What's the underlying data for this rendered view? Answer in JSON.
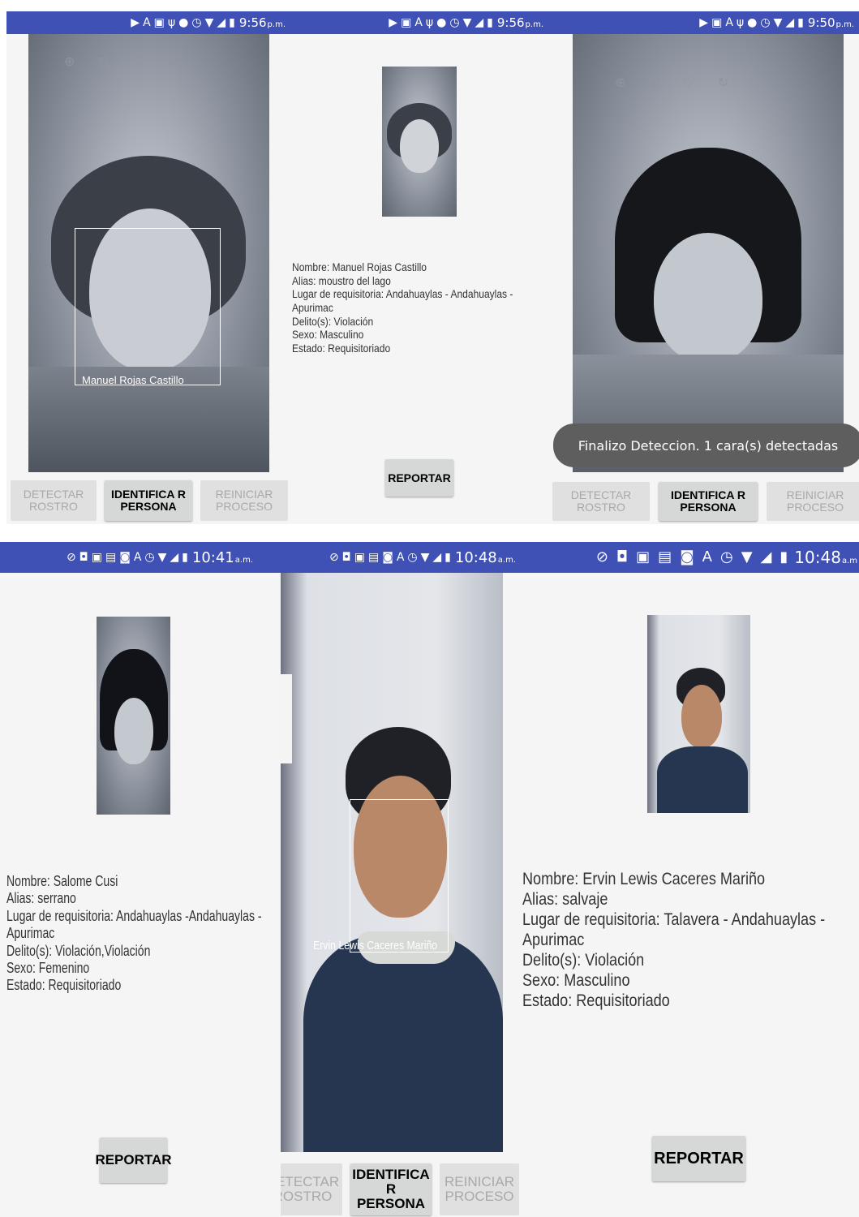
{
  "status_bars": {
    "p1": {
      "time": "9:56",
      "ampm": "p.m.",
      "icons": [
        "youtube-icon",
        "a-icon",
        "image-icon",
        "usb-icon",
        "android-icon",
        "alarm-icon",
        "wifi-icon",
        "signal-icon",
        "battery-icon"
      ]
    },
    "p2": {
      "time": "9:56",
      "ampm": "p.m.",
      "icons": [
        "youtube-icon",
        "image-icon",
        "a-icon",
        "usb-icon",
        "android-icon",
        "alarm-icon",
        "wifi-icon",
        "signal-icon",
        "battery-icon"
      ]
    },
    "p3": {
      "time": "9:50",
      "ampm": "p.m.",
      "icons": [
        "youtube-icon",
        "image-icon",
        "a-icon",
        "usb-icon",
        "android-icon",
        "alarm-icon",
        "wifi-icon",
        "signal-icon",
        "battery-icon"
      ]
    },
    "p4": {
      "time": "10:41",
      "ampm": "a.m.",
      "icons": [
        "block-icon",
        "app-icon",
        "image-icon",
        "gallery-icon",
        "chat-icon",
        "a-icon",
        "alarm-icon",
        "wifi-icon",
        "signal-icon",
        "battery-icon"
      ]
    },
    "p5": {
      "time": "10:48",
      "ampm": "a.m.",
      "icons": [
        "block-icon",
        "app-icon",
        "image-icon",
        "gallery-icon",
        "chat-icon",
        "a-icon",
        "alarm-icon",
        "wifi-icon",
        "signal-icon",
        "battery-icon"
      ]
    },
    "p6": {
      "time": "10:48",
      "ampm": "a.m",
      "icons": [
        "block-icon",
        "app-icon",
        "image-icon",
        "gallery-icon",
        "chat-icon",
        "a-icon",
        "alarm-icon",
        "wifi-icon",
        "signal-icon",
        "battery-icon"
      ]
    }
  },
  "buttons": {
    "detect": "DETECTAR ROSTRO",
    "identify": "IDENTIFICA R PERSONA",
    "restart": "REINICIAR PROCESO",
    "report": "REPORTAR"
  },
  "face_labels": {
    "p1": "Manuel Rojas Castillo",
    "p5": "Ervin Lewis Caceres Mariño"
  },
  "toast": "Finalizo Deteccion. 1 cara(s) detectadas",
  "records": {
    "p2": {
      "nombre": "Nombre: Manuel Rojas Castillo",
      "alias": "Alias: moustro del lago",
      "lugar": "Lugar de requisitoria: Andahuaylas - Andahuaylas -",
      "lugar2": "Apurimac",
      "delito": "Delito(s): Violación",
      "sexo": "Sexo: Masculino",
      "estado": "Estado: Requisitoriado"
    },
    "p4": {
      "nombre": "Nombre: Salome Cusi",
      "alias": "Alias: serrano",
      "lugar": "Lugar de requisitoria: Andahuaylas -Andahuaylas -",
      "lugar2": "Apurimac",
      "delito": "Delito(s): Violación,Violación",
      "sexo": "Sexo: Femenino",
      "estado": "Estado: Requisitoriado"
    },
    "p6": {
      "nombre": "Nombre: Ervin Lewis Caceres Mariño",
      "alias": "Alias: salvaje",
      "lugar": "Lugar de requisitoria: Talavera - Andahuaylas -",
      "lugar2": "Apurimac",
      "delito": "Delito(s): Violación",
      "sexo": "Sexo: Masculino",
      "estado": "Estado: Requisitoriado"
    }
  }
}
